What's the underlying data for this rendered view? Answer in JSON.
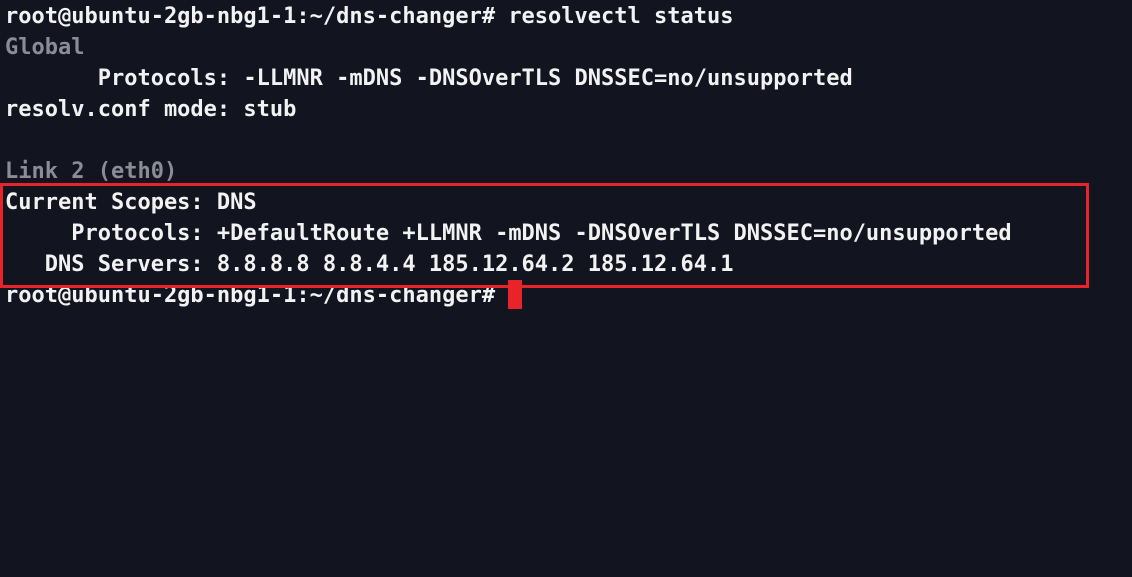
{
  "terminal": {
    "lines": [
      {
        "text": "root@ubuntu-2gb-nbg1-1:~/dns-changer# resolvectl status"
      },
      {
        "text": "Global"
      },
      {
        "text": "       Protocols: -LLMNR -mDNS -DNSOverTLS DNSSEC=no/unsupported"
      },
      {
        "text": "resolv.conf mode: stub"
      },
      {
        "text": ""
      },
      {
        "text": "Link 2 (eth0)"
      },
      {
        "text": "Current Scopes: DNS"
      },
      {
        "text": "     Protocols: +DefaultRoute +LLMNR -mDNS -DNSOverTLS DNSSEC=no/unsupported"
      },
      {
        "text": "   DNS Servers: 8.8.8.8 8.8.4.4 185.12.64.2 185.12.64.1"
      },
      {
        "text": "root@ubuntu-2gb-nbg1-1:~/dns-changer#"
      }
    ]
  },
  "colors": {
    "background": "#12141f",
    "foreground": "#f2f2f2",
    "dim": "#8b8d96",
    "highlight": "#e8232a",
    "cursor": "#e8232a"
  }
}
